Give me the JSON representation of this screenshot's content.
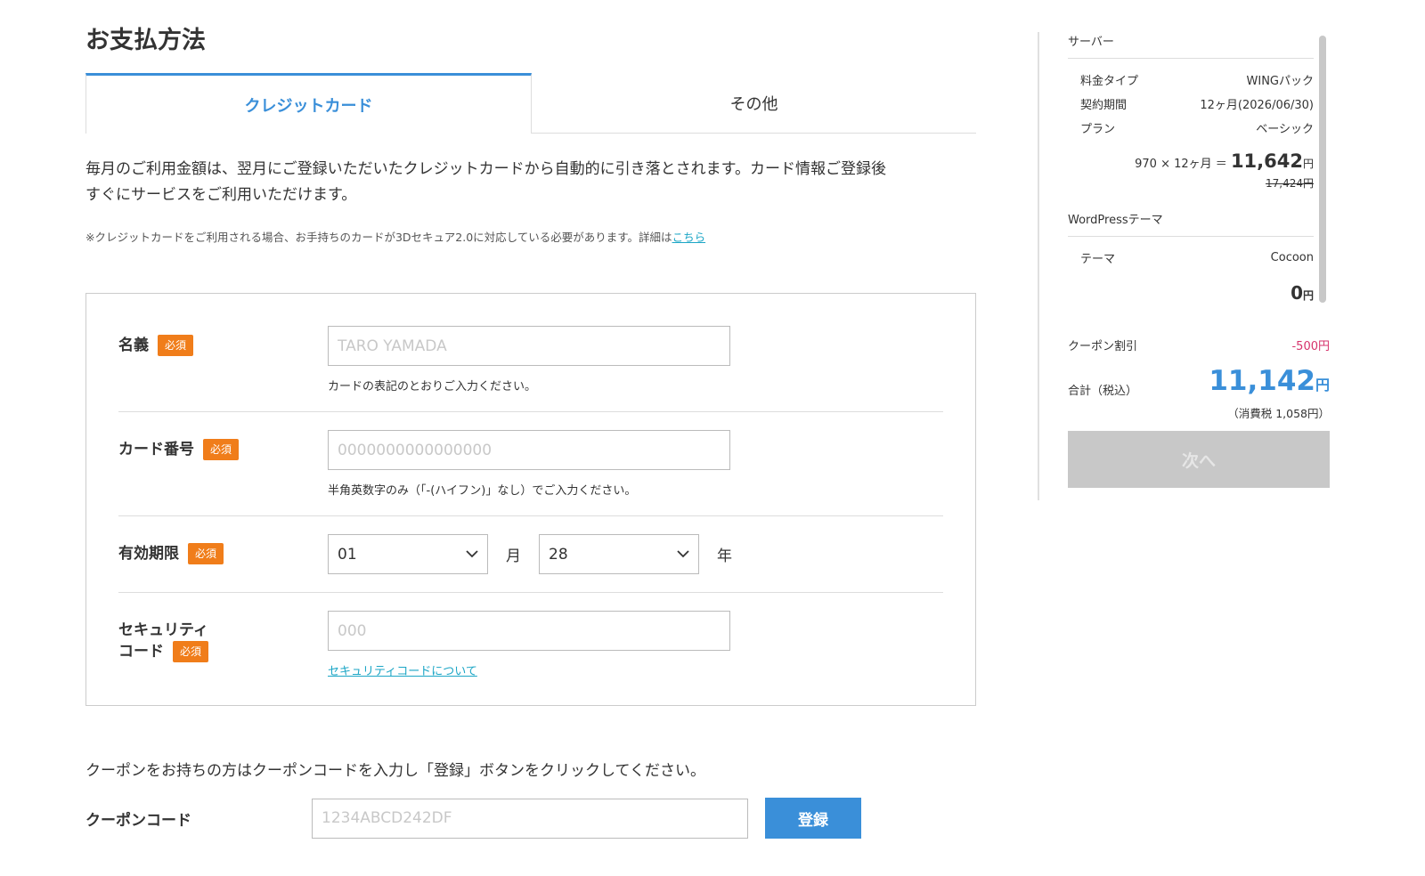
{
  "page": {
    "title": "お支払方法"
  },
  "tabs": [
    {
      "label": "クレジットカード",
      "active": true
    },
    {
      "label": "その他",
      "active": false
    }
  ],
  "description": {
    "line1": "毎月のご利用金額は、翌月にご登録いただいたクレジットカードから自動的に引き落とされます。カード情報ご登録後",
    "line2": "すぐにサービスをご利用いただけます。",
    "note": "※クレジットカードをご利用される場合、お手持ちのカードが3Dセキュア2.0に対応している必要があります。詳細は",
    "note_link": "こちら"
  },
  "form": {
    "required_badge": "必須",
    "name": {
      "label": "名義",
      "placeholder": "TARO YAMADA",
      "help": "カードの表記のとおりご入力ください。"
    },
    "card_number": {
      "label": "カード番号",
      "placeholder": "0000000000000000",
      "help": "半角英数字のみ（「-(ハイフン)」なし）でご入力ください。"
    },
    "expiry": {
      "label": "有効期限",
      "month": "01",
      "month_unit": "月",
      "year": "28",
      "year_unit": "年"
    },
    "security": {
      "label_line1": "セキュリティ",
      "label_line2": "コード",
      "placeholder": "000",
      "link": "セキュリティコードについて"
    }
  },
  "coupon": {
    "instruction": "クーポンをお持ちの方はクーポンコードを入力し「登録」ボタンをクリックしてください。",
    "label": "クーポンコード",
    "placeholder": "1234ABCD242DF",
    "button": "登録"
  },
  "sidebar": {
    "server": {
      "title": "サーバー",
      "rows": [
        {
          "key": "料金タイプ",
          "value": "WINGパック"
        },
        {
          "key": "契約期間",
          "value": "12ヶ月(2026/06/30)"
        },
        {
          "key": "プラン",
          "value": "ベーシック"
        }
      ],
      "formula": "970 × 12ヶ月 ＝",
      "price": "11,642",
      "yen": "円",
      "original": "17,424円"
    },
    "theme": {
      "title": "WordPressテーマ",
      "rows": [
        {
          "key": "テーマ",
          "value": "Cocoon"
        }
      ],
      "price": "0",
      "yen": "円"
    },
    "discount_label": "クーポン割引",
    "discount_value": "-500円",
    "total_label": "合計（税込）",
    "total_value": "11,142",
    "total_yen": "円",
    "tax": "（消費税 1,058円）",
    "next_button": "次へ"
  },
  "colors": {
    "accent": "#3a8fd9",
    "badge": "#f07d1a",
    "discount": "#d6336c",
    "link": "#1ca6c6"
  }
}
